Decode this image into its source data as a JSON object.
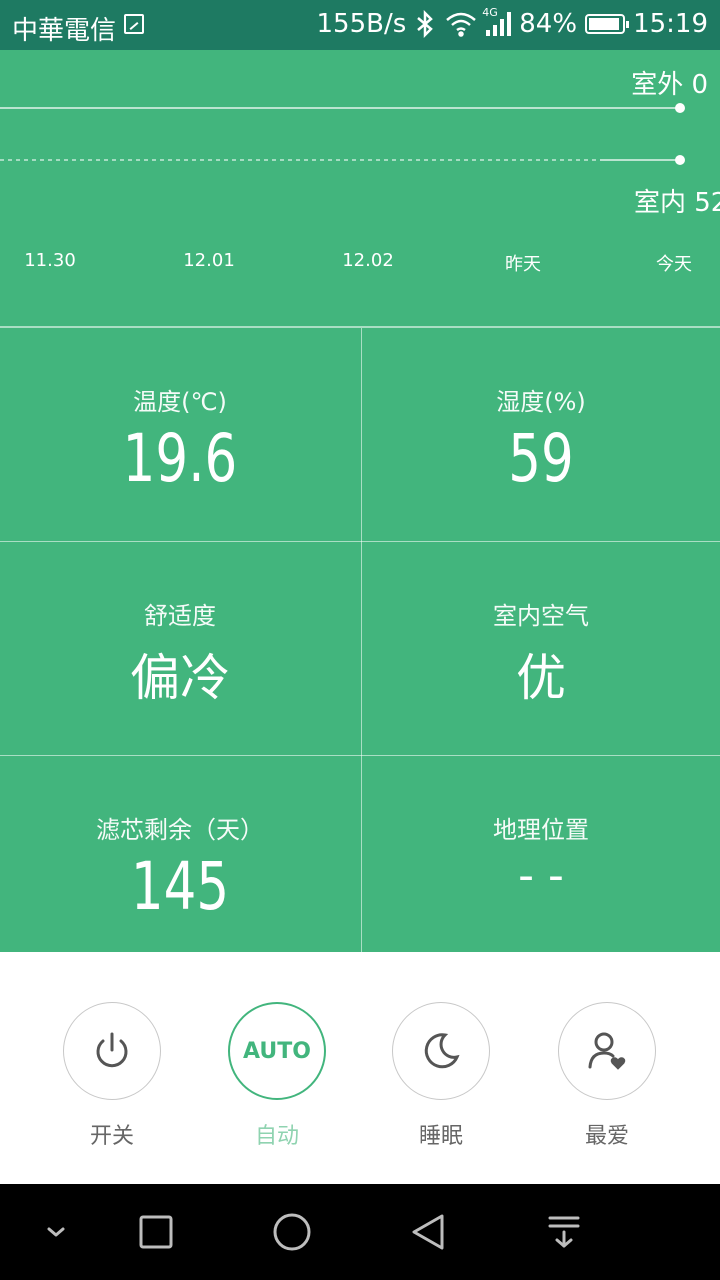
{
  "status": {
    "carrier": "中華電信",
    "speed": "155B/s",
    "network": "4G",
    "battery": "84%",
    "time": "15:19"
  },
  "chart_data": {
    "type": "line",
    "categories": [
      "11.30",
      "12.01",
      "12.02",
      "昨天",
      "今天"
    ],
    "series": [
      {
        "name": "室外",
        "latest": 0
      },
      {
        "name": "室内",
        "latest": 52
      }
    ],
    "labels": {
      "outdoor": "室外 0",
      "indoor": "室内 52"
    }
  },
  "metrics": {
    "temperature": {
      "label": "温度(℃)",
      "value": "19.6"
    },
    "humidity": {
      "label": "湿度(%)",
      "value": "59"
    },
    "comfort": {
      "label": "舒适度",
      "value": "偏冷"
    },
    "air": {
      "label": "室内空气",
      "value": "优"
    },
    "filter": {
      "label": "滤芯剩余（天）",
      "value": "145"
    },
    "location": {
      "label": "地理位置",
      "value": "- -"
    }
  },
  "controls": {
    "power": "开关",
    "auto": "自动",
    "auto_badge": "AUTO",
    "sleep": "睡眠",
    "favorite": "最爱"
  },
  "colors": {
    "primary": "#42b57d",
    "status_bar": "#1e7a62"
  }
}
